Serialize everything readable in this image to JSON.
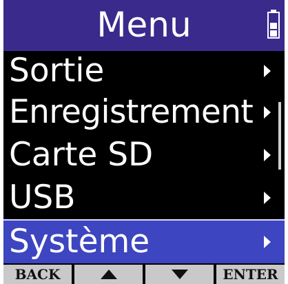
{
  "header": {
    "title": "Menu",
    "battery_icon": "battery-icon"
  },
  "menu": {
    "items": [
      {
        "label": "Sortie",
        "selected": false
      },
      {
        "label": "Enregistrement",
        "selected": false
      },
      {
        "label": "Carte SD",
        "selected": false
      },
      {
        "label": "USB",
        "selected": false
      },
      {
        "label": "Système",
        "selected": true
      }
    ]
  },
  "footer": {
    "back_label": "BACK",
    "up_icon": "triangle-up-icon",
    "down_icon": "triangle-down-icon",
    "enter_label": "ENTER"
  },
  "colors": {
    "header_bg": "#3a2a8c",
    "screen_bg": "#000000",
    "selected_bg": "#3d45c0",
    "footer_bg": "#c9c9c9"
  }
}
